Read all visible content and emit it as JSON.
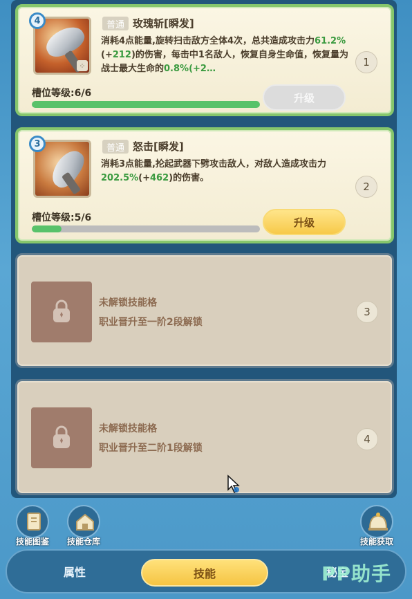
{
  "slots": [
    {
      "level": "4",
      "tag": "普通",
      "name": "玫瑰斩[瞬发]",
      "desc_parts": [
        "消耗4点能量,旋转扫击敌方全体4次，总共造成攻击力",
        "61.2%",
        "(+",
        "212",
        ")的伤害，每击中1名敌人，恢复自身生命值，恢复量为战士最大生命的",
        "0.8%",
        "(+2…"
      ],
      "slot_level": "槽位等级:6/6",
      "progress": 1.0,
      "upgrade": "升级",
      "number": "1"
    },
    {
      "level": "3",
      "tag": "普通",
      "name": "怒击[瞬发]",
      "desc_parts": [
        "消耗3点能量,抡起武器下劈攻击敌人，对敌人造成攻击力",
        "202.5%",
        "(+",
        "462",
        ")的伤害。"
      ],
      "slot_level": "槽位等级:5/6",
      "progress": 0.13,
      "upgrade": "升级",
      "number": "2"
    },
    {
      "locked_title": "未解锁技能格",
      "locked_cond": "职业晋升至一阶2段解锁",
      "number": "3"
    },
    {
      "locked_title": "未解锁技能格",
      "locked_cond": "职业晋升至二阶1段解锁",
      "number": "4"
    }
  ],
  "quick": {
    "atlas": "技能图鉴",
    "warehouse": "技能仓库",
    "obtain": "技能获取"
  },
  "tabs": {
    "attr": "属性",
    "skill": "技能",
    "secret": "秘宝"
  },
  "watermark": "PP助手",
  "colors": {
    "accent_green": "#3a9a3f",
    "button_gold": "#f7c94a",
    "progress_green": "#58c26a"
  }
}
